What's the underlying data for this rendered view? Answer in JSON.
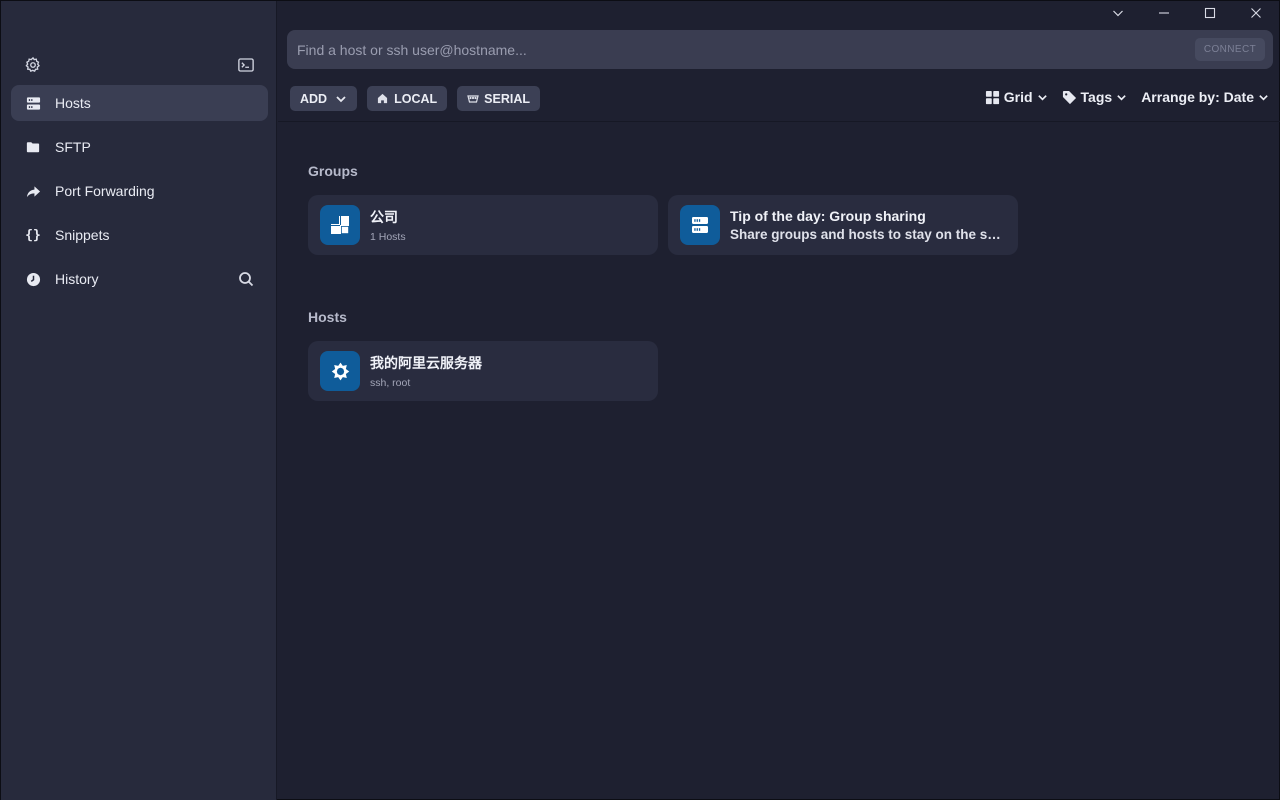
{
  "sidebar": {
    "top_icons": {
      "settings": "gear-icon",
      "terminal": "terminal-icon"
    },
    "items": [
      {
        "label": "Hosts",
        "icon": "hosts-icon",
        "active": true
      },
      {
        "label": "SFTP",
        "icon": "folder-icon",
        "active": false
      },
      {
        "label": "Port Forwarding",
        "icon": "forward-arrow-icon",
        "active": false
      },
      {
        "label": "Snippets",
        "icon": "braces-icon",
        "active": false
      },
      {
        "label": "History",
        "icon": "clock-icon",
        "active": false
      }
    ]
  },
  "search": {
    "placeholder": "Find a host or ssh user@hostname...",
    "value": "",
    "connect_label": "CONNECT"
  },
  "toolbar": {
    "add_label": "ADD",
    "local_label": "LOCAL",
    "serial_label": "SERIAL",
    "view_label": "Grid",
    "tags_label": "Tags",
    "arrange_label": "Arrange by: Date"
  },
  "groups_section": {
    "title": "Groups",
    "cards": [
      {
        "title": "公司",
        "subtitle": "1 Hosts"
      },
      {
        "title": "Tip of the day: Group sharing",
        "subtitle": "Share groups and hosts to stay on the sa..."
      }
    ]
  },
  "hosts_section": {
    "title": "Hosts",
    "cards": [
      {
        "title": "我的阿里云服务器",
        "subtitle": "ssh, root"
      }
    ]
  },
  "colors": {
    "background": "#1e2030",
    "sidebar": "#272a3c",
    "card": "#292c3f",
    "accent_icon_bg": "#0f5c9a"
  }
}
